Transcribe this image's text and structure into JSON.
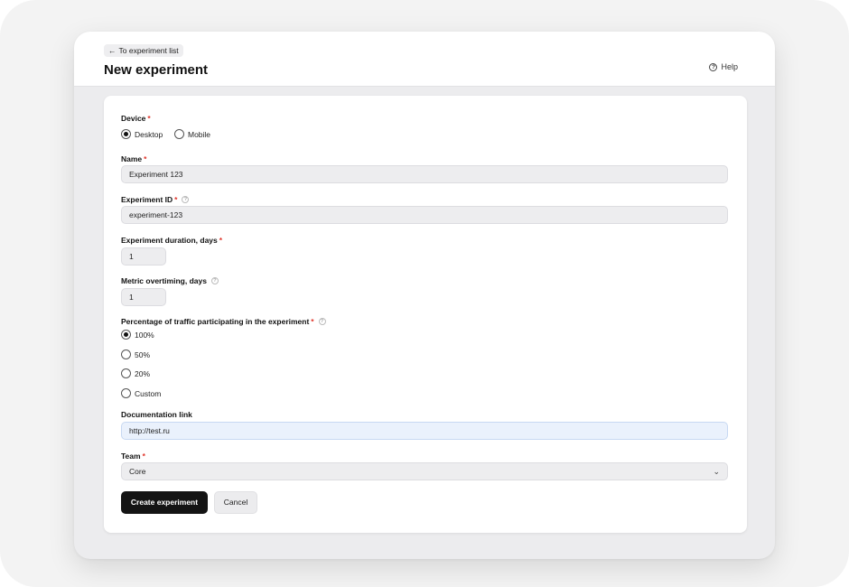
{
  "header": {
    "back_label": "To experiment list",
    "title": "New experiment",
    "help_label": "Help"
  },
  "form": {
    "device": {
      "label": "Device",
      "options": [
        "Desktop",
        "Mobile"
      ],
      "selected": "Desktop"
    },
    "name": {
      "label": "Name",
      "value": "Experiment 123"
    },
    "experiment_id": {
      "label": "Experiment ID",
      "value": "experiment-123"
    },
    "duration": {
      "label": "Experiment duration, days",
      "value": "1"
    },
    "overtiming": {
      "label": "Metric overtiming, days",
      "value": "1"
    },
    "traffic": {
      "label": "Percentage of traffic participating in the experiment",
      "options": [
        "100%",
        "50%",
        "20%",
        "Custom"
      ],
      "selected": "100%"
    },
    "doc_link": {
      "label": "Documentation link",
      "value": "http://test.ru"
    },
    "team": {
      "label": "Team",
      "value": "Core"
    },
    "required_mark": "*"
  },
  "actions": {
    "create_label": "Create experiment",
    "cancel_label": "Cancel"
  },
  "colors": {
    "required": "#e0352b",
    "primary_button": "#141414",
    "focused_input": "#eaf1fc"
  }
}
